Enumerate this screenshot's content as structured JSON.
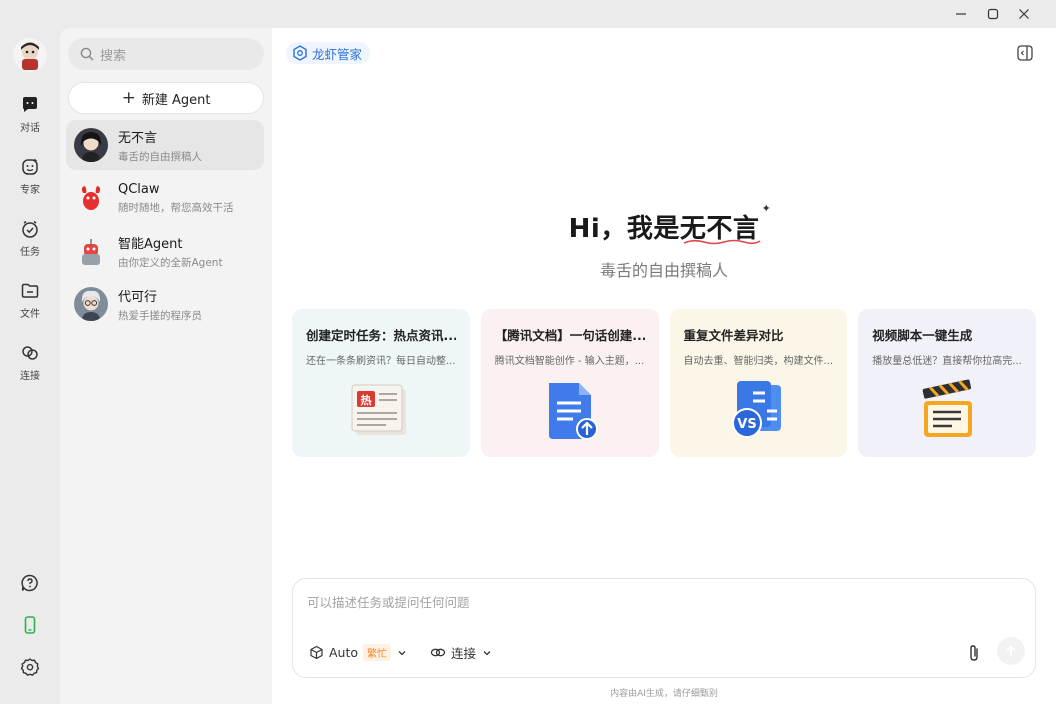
{
  "window": {
    "minimize_icon": "minimize-icon",
    "maximize_icon": "maximize-icon",
    "close_icon": "close-icon"
  },
  "rail": {
    "items": [
      {
        "label": "对话",
        "icon": "chat-bubble-icon"
      },
      {
        "label": "专家",
        "icon": "expert-face-icon"
      },
      {
        "label": "任务",
        "icon": "task-check-icon"
      },
      {
        "label": "文件",
        "icon": "folder-icon"
      },
      {
        "label": "连接",
        "icon": "link-icon"
      }
    ],
    "bottom_icons": [
      "help-icon",
      "phone-icon",
      "settings-icon"
    ]
  },
  "sidebar": {
    "search_placeholder": "搜索",
    "new_agent_label": "新建 Agent",
    "agents": [
      {
        "name": "无不言",
        "desc": "毒舌的自由撰稿人"
      },
      {
        "name": "QClaw",
        "desc": "随时随地，帮您高效干活"
      },
      {
        "name": "智能Agent",
        "desc": "由你定义的全新Agent"
      },
      {
        "name": "代可行",
        "desc": "热爱手搓的程序员"
      }
    ]
  },
  "main": {
    "brand_tag": "龙虾管家",
    "hero_prefix": "Hi，我是",
    "hero_name": "无不言",
    "hero_subtitle": "毒舌的自由撰稿人",
    "cards": [
      {
        "title": "创建定时任务：热点资讯...",
        "desc": "还在一条条刷资讯？每日自动整...",
        "icon": "hot-news-icon"
      },
      {
        "title": "【腾讯文档】一句话创建...",
        "desc": "腾讯文档智能创作 - 输入主题，...",
        "icon": "document-create-icon"
      },
      {
        "title": "重复文件差异对比",
        "desc": "自动去重、智能归类，构建文件...",
        "icon": "file-compare-icon"
      },
      {
        "title": "视频脚本一键生成",
        "desc": "播放量总低迷？直接帮你拉高完...",
        "icon": "clapperboard-icon"
      }
    ],
    "composer": {
      "placeholder": "可以描述任务或提问任何问题",
      "model_label": "Auto",
      "model_badge": "繁忙",
      "connect_label": "连接"
    },
    "footnote": "内容由AI生成，请仔细甄别"
  },
  "colors": {
    "accent_blue": "#2f6fd6",
    "busy_orange": "#f08a2a",
    "phone_green": "#2bb24c"
  }
}
